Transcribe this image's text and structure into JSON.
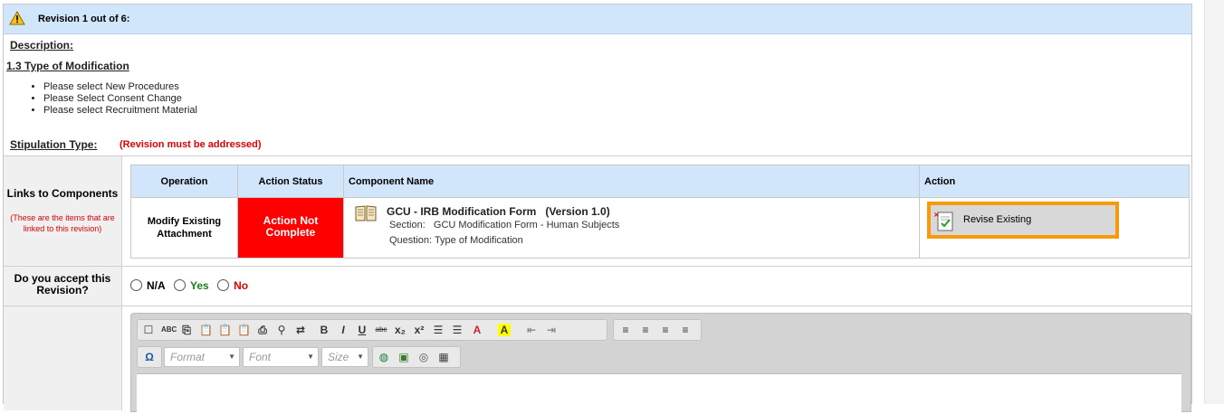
{
  "revision": {
    "title": "Revision 1 out of 6:",
    "description_label": "Description:",
    "section_title": "1.3 Type of Modification",
    "items": [
      "Please select New Procedures",
      "Please Select Consent Change",
      "Please select Recruitment Material"
    ],
    "stipulation_label": "Stipulation Type:",
    "stipulation_note": "(Revision must be addressed)"
  },
  "links": {
    "label": "Links to Components",
    "note": "(These are the items that are linked to this revision)",
    "headers": {
      "operation": "Operation",
      "action_status": "Action Status",
      "component_name": "Component Name",
      "action": "Action"
    },
    "row": {
      "operation": "Modify Existing Attachment",
      "action_status": "Action Not Complete",
      "component_title": "GCU - IRB Modification Form   (Version 1.0)",
      "section": "Section:   GCU Modification Form - Human Subjects",
      "question": "Question: Type of Modification",
      "action_button": "Revise Existing"
    }
  },
  "accept": {
    "label": "Do you accept this Revision?",
    "options": [
      "N/A",
      "Yes",
      "No"
    ]
  },
  "editor": {
    "format_placeholder": "Format",
    "font_placeholder": "Font",
    "size_placeholder": "Size"
  },
  "colors": {
    "header_bg": "#d1e6fb",
    "status_red": "#ff0000",
    "button_border": "#f59a0c",
    "yes_green": "#1a7f1a",
    "no_red": "#e00000"
  }
}
